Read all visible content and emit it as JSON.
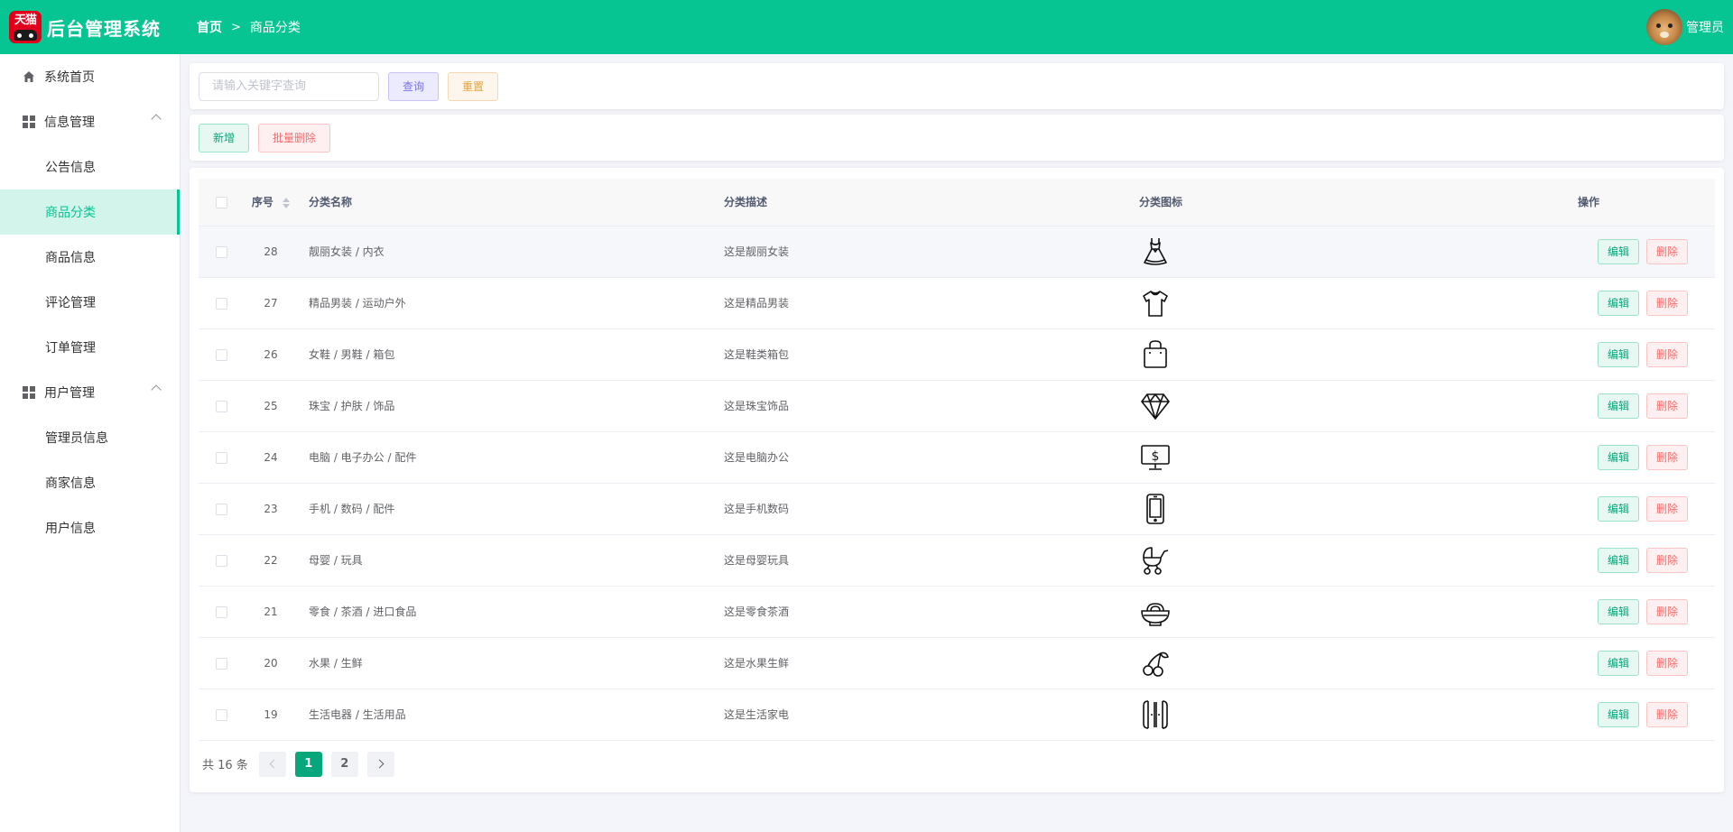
{
  "header": {
    "logo_text": "天猫",
    "app_title": "后台管理系统",
    "breadcrumb": {
      "home": "首页",
      "current": "商品分类"
    },
    "user_name": "管理员"
  },
  "sidebar": {
    "home": "系统首页",
    "groups": [
      {
        "label": "信息管理",
        "items": [
          "公告信息",
          "商品分类",
          "商品信息",
          "评论管理",
          "订单管理"
        ]
      },
      {
        "label": "用户管理",
        "items": [
          "管理员信息",
          "商家信息",
          "用户信息"
        ]
      }
    ],
    "active_item": "商品分类"
  },
  "search": {
    "placeholder": "请输入关键字查询",
    "value": "",
    "query_label": "查询",
    "reset_label": "重置"
  },
  "actions": {
    "add_label": "新增",
    "batch_delete_label": "批量删除"
  },
  "table": {
    "columns": {
      "id": "序号",
      "name": "分类名称",
      "desc": "分类描述",
      "icon": "分类图标",
      "ops": "操作"
    },
    "edit_label": "编辑",
    "delete_label": "删除",
    "rows": [
      {
        "id": "28",
        "name": "靓丽女装 / 内衣",
        "desc": "这是靓丽女装",
        "icon": "dress-icon"
      },
      {
        "id": "27",
        "name": "精品男装 / 运动户外",
        "desc": "这是精品男装",
        "icon": "tshirt-icon"
      },
      {
        "id": "26",
        "name": "女鞋 / 男鞋 / 箱包",
        "desc": "这是鞋类箱包",
        "icon": "bag-icon"
      },
      {
        "id": "25",
        "name": "珠宝 / 护肤 / 饰品",
        "desc": "这是珠宝饰品",
        "icon": "diamond-icon"
      },
      {
        "id": "24",
        "name": "电脑 / 电子办公 / 配件",
        "desc": "这是电脑办公",
        "icon": "monitor-icon"
      },
      {
        "id": "23",
        "name": "手机 / 数码 / 配件",
        "desc": "这是手机数码",
        "icon": "phone-icon"
      },
      {
        "id": "22",
        "name": "母婴 / 玩具",
        "desc": "这是母婴玩具",
        "icon": "stroller-icon"
      },
      {
        "id": "21",
        "name": "零食 / 茶酒 / 进口食品",
        "desc": "这是零食茶酒",
        "icon": "noodle-bowl-icon"
      },
      {
        "id": "20",
        "name": "水果 / 生鲜",
        "desc": "这是水果生鲜",
        "icon": "cherry-icon"
      },
      {
        "id": "19",
        "name": "生活电器 / 生活用品",
        "desc": "这是生活家电",
        "icon": "fridge-icon"
      }
    ]
  },
  "pagination": {
    "total_text": "共 16 条",
    "pages": [
      "1",
      "2"
    ],
    "current": "1"
  },
  "colors": {
    "primary": "#07c592",
    "danger": "#f56c6c",
    "warning": "#e6a23c"
  }
}
